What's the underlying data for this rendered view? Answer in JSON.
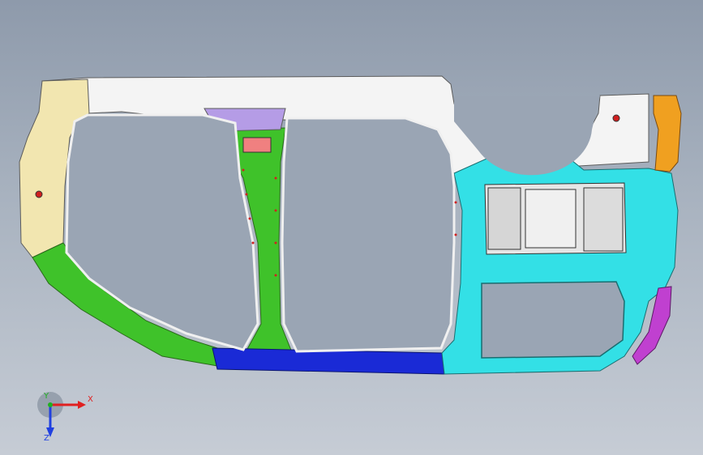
{
  "viewport": {
    "background_top": "#8e9aab",
    "background_bottom": "#c6ccd5"
  },
  "triad": {
    "x_label": "X",
    "y_label": "Y",
    "z_label": "Z",
    "x_color": "#e02020",
    "y_color": "#20b020",
    "z_color": "#2040e0"
  },
  "parts": {
    "front_pillar_color": "#f2e6b0",
    "b_pillar_color": "#3fc22a",
    "rocker_color": "#1a2ad6",
    "rear_quarter_color": "#33e0e6",
    "roof_rail_color": "#f4f4f4",
    "rear_bracket_color": "#f0a020",
    "bracket_purple_color": "#b59ce6",
    "tail_purple_color": "#c040d0"
  }
}
